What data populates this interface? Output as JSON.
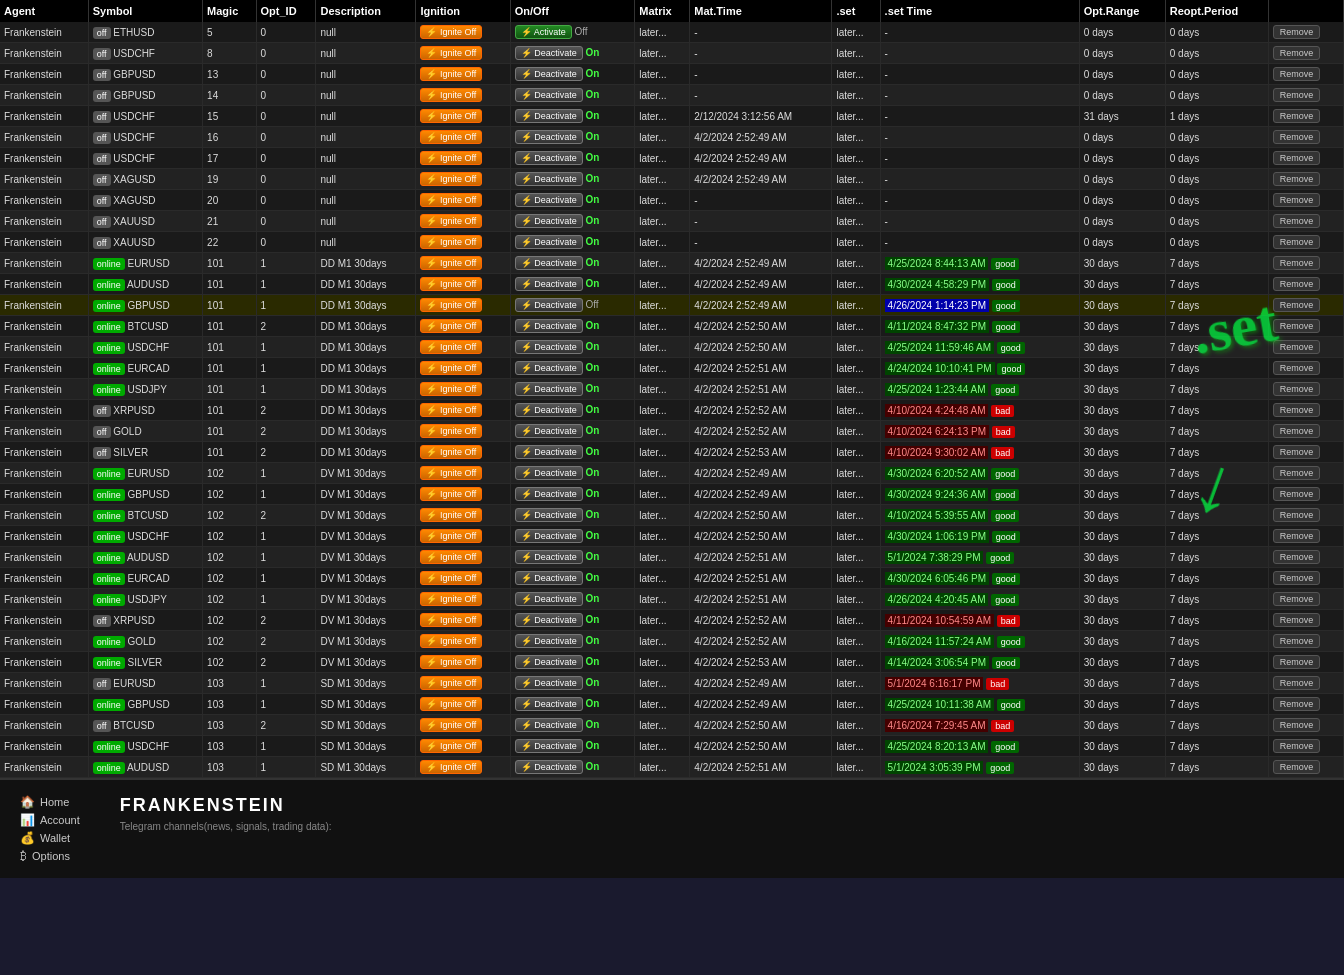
{
  "watermark": {
    "text": ".set",
    "arrow": "↓"
  },
  "table": {
    "headers": [
      "Agent",
      "Symbol",
      "Magic",
      "Opt_ID",
      "Description",
      "Ignition",
      "On/Off",
      "Matrix",
      "Mat.Time",
      ".set",
      ".set Time",
      "Opt.Range",
      "Reopt.Period",
      ""
    ],
    "rows": [
      {
        "agent": "Frankenstein",
        "status": "off",
        "symbol": "ETHUSD",
        "magic": 5,
        "opt_id": 0,
        "desc": "null",
        "ignition": "Ignite",
        "onoff_btn": "Activate",
        "onoff_state": "Off",
        "matrix": "later...",
        "mat_time": "-",
        "set": "later...",
        "set_time": "-",
        "set_quality": "",
        "opt_range": "0 days",
        "reopt": "0 days"
      },
      {
        "agent": "Frankenstein",
        "status": "off",
        "symbol": "USDCHF",
        "magic": 8,
        "opt_id": 0,
        "desc": "null",
        "ignition": "Ignite",
        "onoff_btn": "Deactivate",
        "onoff_state": "On",
        "matrix": "later...",
        "mat_time": "-",
        "set": "later...",
        "set_time": "-",
        "set_quality": "",
        "opt_range": "0 days",
        "reopt": "0 days"
      },
      {
        "agent": "Frankenstein",
        "status": "off",
        "symbol": "GBPUSD",
        "magic": 13,
        "opt_id": 0,
        "desc": "null",
        "ignition": "Ignite",
        "onoff_btn": "Deactivate",
        "onoff_state": "On",
        "matrix": "later...",
        "mat_time": "-",
        "set": "later...",
        "set_time": "-",
        "set_quality": "",
        "opt_range": "0 days",
        "reopt": "0 days"
      },
      {
        "agent": "Frankenstein",
        "status": "off",
        "symbol": "GBPUSD",
        "magic": 14,
        "opt_id": 0,
        "desc": "null",
        "ignition": "Ignite",
        "onoff_btn": "Deactivate",
        "onoff_state": "On",
        "matrix": "later...",
        "mat_time": "-",
        "set": "later...",
        "set_time": "-",
        "set_quality": "",
        "opt_range": "0 days",
        "reopt": "0 days"
      },
      {
        "agent": "Frankenstein",
        "status": "off",
        "symbol": "USDCHF",
        "magic": 15,
        "opt_id": 0,
        "desc": "null",
        "ignition": "Ignite",
        "onoff_btn": "Deactivate",
        "onoff_state": "On",
        "matrix": "later...",
        "mat_time": "2/12/2024 3:12:56 AM",
        "set": "later...",
        "set_time": "-",
        "set_quality": "",
        "opt_range": "31 days",
        "reopt": "1 days"
      },
      {
        "agent": "Frankenstein",
        "status": "off",
        "symbol": "USDCHF",
        "magic": 16,
        "opt_id": 0,
        "desc": "null",
        "ignition": "Ignite",
        "onoff_btn": "Deactivate",
        "onoff_state": "On",
        "matrix": "later...",
        "mat_time": "4/2/2024 2:52:49 AM",
        "set": "later...",
        "set_time": "-",
        "set_quality": "",
        "opt_range": "0 days",
        "reopt": "0 days"
      },
      {
        "agent": "Frankenstein",
        "status": "off",
        "symbol": "USDCHF",
        "magic": 17,
        "opt_id": 0,
        "desc": "null",
        "ignition": "Ignite",
        "onoff_btn": "Deactivate",
        "onoff_state": "On",
        "matrix": "later...",
        "mat_time": "4/2/2024 2:52:49 AM",
        "set": "later...",
        "set_time": "-",
        "set_quality": "",
        "opt_range": "0 days",
        "reopt": "0 days"
      },
      {
        "agent": "Frankenstein",
        "status": "off",
        "symbol": "XAGUSD",
        "magic": 19,
        "opt_id": 0,
        "desc": "null",
        "ignition": "Ignite",
        "onoff_btn": "Deactivate",
        "onoff_state": "On",
        "matrix": "later...",
        "mat_time": "4/2/2024 2:52:49 AM",
        "set": "later...",
        "set_time": "-",
        "set_quality": "",
        "opt_range": "0 days",
        "reopt": "0 days"
      },
      {
        "agent": "Frankenstein",
        "status": "off",
        "symbol": "XAGUSD",
        "magic": 20,
        "opt_id": 0,
        "desc": "null",
        "ignition": "Ignite",
        "onoff_btn": "Deactivate",
        "onoff_state": "On",
        "matrix": "later...",
        "mat_time": "-",
        "set": "later...",
        "set_time": "-",
        "set_quality": "",
        "opt_range": "0 days",
        "reopt": "0 days"
      },
      {
        "agent": "Frankenstein",
        "status": "off",
        "symbol": "XAUUSD",
        "magic": 21,
        "opt_id": 0,
        "desc": "null",
        "ignition": "Ignite",
        "onoff_btn": "Deactivate",
        "onoff_state": "On",
        "matrix": "later...",
        "mat_time": "-",
        "set": "later...",
        "set_time": "-",
        "set_quality": "",
        "opt_range": "0 days",
        "reopt": "0 days"
      },
      {
        "agent": "Frankenstein",
        "status": "off",
        "symbol": "XAUUSD",
        "magic": 22,
        "opt_id": 0,
        "desc": "null",
        "ignition": "Ignite",
        "onoff_btn": "Deactivate",
        "onoff_state": "On",
        "matrix": "later...",
        "mat_time": "-",
        "set": "later...",
        "set_time": "-",
        "set_quality": "",
        "opt_range": "0 days",
        "reopt": "0 days"
      },
      {
        "agent": "Frankenstein",
        "status": "online",
        "symbol": "EURUSD",
        "magic": 101,
        "opt_id": 1,
        "desc": "DD M1 30days",
        "ignition": "Ignite",
        "onoff_btn": "Deactivate",
        "onoff_state": "On",
        "matrix": "later...",
        "mat_time": "4/2/2024 2:52:49 AM",
        "set": "later...",
        "set_time": "4/25/2024 8:44:13 AM",
        "set_quality": "good",
        "opt_range": "30 days",
        "reopt": "7 days"
      },
      {
        "agent": "Frankenstein",
        "status": "online",
        "symbol": "AUDUSD",
        "magic": 101,
        "opt_id": 1,
        "desc": "DD M1 30days",
        "ignition": "Ignite",
        "onoff_btn": "Deactivate",
        "onoff_state": "On",
        "matrix": "later...",
        "mat_time": "4/2/2024 2:52:49 AM",
        "set": "later...",
        "set_time": "4/30/2024 4:58:29 PM",
        "set_quality": "good",
        "opt_range": "30 days",
        "reopt": "7 days"
      },
      {
        "agent": "Frankenstein",
        "status": "online",
        "symbol": "GBPUSD",
        "magic": 101,
        "opt_id": 1,
        "desc": "DD M1 30days",
        "ignition": "Ignite",
        "onoff_btn": "Deactivate",
        "onoff_state": "Off",
        "matrix": "later...",
        "mat_time": "4/2/2024 2:52:49 AM",
        "set": "later...",
        "set_time": "4/26/2024 1:14:23 PM",
        "set_quality": "good",
        "opt_range": "30 days",
        "reopt": "7 days",
        "highlight": true
      },
      {
        "agent": "Frankenstein",
        "status": "online",
        "symbol": "BTCUSD",
        "magic": 101,
        "opt_id": 2,
        "desc": "DD M1 30days",
        "ignition": "Ignite",
        "onoff_btn": "Deactivate",
        "onoff_state": "On",
        "matrix": "later...",
        "mat_time": "4/2/2024 2:52:50 AM",
        "set": "later...",
        "set_time": "4/11/2024 8:47:32 PM",
        "set_quality": "good",
        "opt_range": "30 days",
        "reopt": "7 days"
      },
      {
        "agent": "Frankenstein",
        "status": "online",
        "symbol": "USDCHF",
        "magic": 101,
        "opt_id": 1,
        "desc": "DD M1 30days",
        "ignition": "Ignite",
        "onoff_btn": "Deactivate",
        "onoff_state": "On",
        "matrix": "later...",
        "mat_time": "4/2/2024 2:52:50 AM",
        "set": "later...",
        "set_time": "4/25/2024 11:59:46 AM",
        "set_quality": "good",
        "opt_range": "30 days",
        "reopt": "7 days"
      },
      {
        "agent": "Frankenstein",
        "status": "online",
        "symbol": "EURCAD",
        "magic": 101,
        "opt_id": 1,
        "desc": "DD M1 30days",
        "ignition": "Ignite",
        "onoff_btn": "Deactivate",
        "onoff_state": "On",
        "matrix": "later...",
        "mat_time": "4/2/2024 2:52:51 AM",
        "set": "later...",
        "set_time": "4/24/2024 10:10:41 PM",
        "set_quality": "good",
        "opt_range": "30 days",
        "reopt": "7 days"
      },
      {
        "agent": "Frankenstein",
        "status": "online",
        "symbol": "USDJPY",
        "magic": 101,
        "opt_id": 1,
        "desc": "DD M1 30days",
        "ignition": "Ignite",
        "onoff_btn": "Deactivate",
        "onoff_state": "On",
        "matrix": "later...",
        "mat_time": "4/2/2024 2:52:51 AM",
        "set": "later...",
        "set_time": "4/25/2024 1:23:44 AM",
        "set_quality": "good",
        "opt_range": "30 days",
        "reopt": "7 days"
      },
      {
        "agent": "Frankenstein",
        "status": "off",
        "symbol": "XRPUSD",
        "magic": 101,
        "opt_id": 2,
        "desc": "DD M1 30days",
        "ignition": "Ignite",
        "onoff_btn": "Deactivate",
        "onoff_state": "On",
        "matrix": "later...",
        "mat_time": "4/2/2024 2:52:52 AM",
        "set": "later...",
        "set_time": "4/10/2024 4:24:48 AM",
        "set_quality": "bad",
        "opt_range": "30 days",
        "reopt": "7 days"
      },
      {
        "agent": "Frankenstein",
        "status": "off",
        "symbol": "GOLD",
        "magic": 101,
        "opt_id": 2,
        "desc": "DD M1 30days",
        "ignition": "Ignite",
        "onoff_btn": "Deactivate",
        "onoff_state": "On",
        "matrix": "later...",
        "mat_time": "4/2/2024 2:52:52 AM",
        "set": "later...",
        "set_time": "4/10/2024 6:24:13 PM",
        "set_quality": "bad",
        "opt_range": "30 days",
        "reopt": "7 days"
      },
      {
        "agent": "Frankenstein",
        "status": "off",
        "symbol": "SILVER",
        "magic": 101,
        "opt_id": 2,
        "desc": "DD M1 30days",
        "ignition": "Ignite",
        "onoff_btn": "Deactivate",
        "onoff_state": "On",
        "matrix": "later...",
        "mat_time": "4/2/2024 2:52:53 AM",
        "set": "later...",
        "set_time": "4/10/2024 9:30:02 AM",
        "set_quality": "bad",
        "opt_range": "30 days",
        "reopt": "7 days"
      },
      {
        "agent": "Frankenstein",
        "status": "online",
        "symbol": "EURUSD",
        "magic": 102,
        "opt_id": 1,
        "desc": "DV M1 30days",
        "ignition": "Ignite",
        "onoff_btn": "Deactivate",
        "onoff_state": "On",
        "matrix": "later...",
        "mat_time": "4/2/2024 2:52:49 AM",
        "set": "later...",
        "set_time": "4/30/2024 6:20:52 AM",
        "set_quality": "good",
        "opt_range": "30 days",
        "reopt": "7 days"
      },
      {
        "agent": "Frankenstein",
        "status": "online",
        "symbol": "GBPUSD",
        "magic": 102,
        "opt_id": 1,
        "desc": "DV M1 30days",
        "ignition": "Ignite",
        "onoff_btn": "Deactivate",
        "onoff_state": "On",
        "matrix": "later...",
        "mat_time": "4/2/2024 2:52:49 AM",
        "set": "later...",
        "set_time": "4/30/2024 9:24:36 AM",
        "set_quality": "good",
        "opt_range": "30 days",
        "reopt": "7 days"
      },
      {
        "agent": "Frankenstein",
        "status": "online",
        "symbol": "BTCUSD",
        "magic": 102,
        "opt_id": 2,
        "desc": "DV M1 30days",
        "ignition": "Ignite",
        "onoff_btn": "Deactivate",
        "onoff_state": "On",
        "matrix": "later...",
        "mat_time": "4/2/2024 2:52:50 AM",
        "set": "later...",
        "set_time": "4/10/2024 5:39:55 AM",
        "set_quality": "good",
        "opt_range": "30 days",
        "reopt": "7 days"
      },
      {
        "agent": "Frankenstein",
        "status": "online",
        "symbol": "USDCHF",
        "magic": 102,
        "opt_id": 1,
        "desc": "DV M1 30days",
        "ignition": "Ignite",
        "onoff_btn": "Deactivate",
        "onoff_state": "On",
        "matrix": "later...",
        "mat_time": "4/2/2024 2:52:50 AM",
        "set": "later...",
        "set_time": "4/30/2024 1:06:19 PM",
        "set_quality": "good",
        "opt_range": "30 days",
        "reopt": "7 days"
      },
      {
        "agent": "Frankenstein",
        "status": "online",
        "symbol": "AUDUSD",
        "magic": 102,
        "opt_id": 1,
        "desc": "DV M1 30days",
        "ignition": "Ignite",
        "onoff_btn": "Deactivate",
        "onoff_state": "On",
        "matrix": "later...",
        "mat_time": "4/2/2024 2:52:51 AM",
        "set": "later...",
        "set_time": "5/1/2024 7:38:29 PM",
        "set_quality": "good",
        "opt_range": "30 days",
        "reopt": "7 days"
      },
      {
        "agent": "Frankenstein",
        "status": "online",
        "symbol": "EURCAD",
        "magic": 102,
        "opt_id": 1,
        "desc": "DV M1 30days",
        "ignition": "Ignite",
        "onoff_btn": "Deactivate",
        "onoff_state": "On",
        "matrix": "later...",
        "mat_time": "4/2/2024 2:52:51 AM",
        "set": "later...",
        "set_time": "4/30/2024 6:05:46 PM",
        "set_quality": "good",
        "opt_range": "30 days",
        "reopt": "7 days"
      },
      {
        "agent": "Frankenstein",
        "status": "online",
        "symbol": "USDJPY",
        "magic": 102,
        "opt_id": 1,
        "desc": "DV M1 30days",
        "ignition": "Ignite",
        "onoff_btn": "Deactivate",
        "onoff_state": "On",
        "matrix": "later...",
        "mat_time": "4/2/2024 2:52:51 AM",
        "set": "later...",
        "set_time": "4/26/2024 4:20:45 AM",
        "set_quality": "good",
        "opt_range": "30 days",
        "reopt": "7 days"
      },
      {
        "agent": "Frankenstein",
        "status": "off",
        "symbol": "XRPUSD",
        "magic": 102,
        "opt_id": 2,
        "desc": "DV M1 30days",
        "ignition": "Ignite",
        "onoff_btn": "Deactivate",
        "onoff_state": "On",
        "matrix": "later...",
        "mat_time": "4/2/2024 2:52:52 AM",
        "set": "later...",
        "set_time": "4/11/2024 10:54:59 AM",
        "set_quality": "bad",
        "opt_range": "30 days",
        "reopt": "7 days"
      },
      {
        "agent": "Frankenstein",
        "status": "online",
        "symbol": "GOLD",
        "magic": 102,
        "opt_id": 2,
        "desc": "DV M1 30days",
        "ignition": "Ignite",
        "onoff_btn": "Deactivate",
        "onoff_state": "On",
        "matrix": "later...",
        "mat_time": "4/2/2024 2:52:52 AM",
        "set": "later...",
        "set_time": "4/16/2024 11:57:24 AM",
        "set_quality": "good",
        "opt_range": "30 days",
        "reopt": "7 days"
      },
      {
        "agent": "Frankenstein",
        "status": "online",
        "symbol": "SILVER",
        "magic": 102,
        "opt_id": 2,
        "desc": "DV M1 30days",
        "ignition": "Ignite",
        "onoff_btn": "Deactivate",
        "onoff_state": "On",
        "matrix": "later...",
        "mat_time": "4/2/2024 2:52:53 AM",
        "set": "later...",
        "set_time": "4/14/2024 3:06:54 PM",
        "set_quality": "good",
        "opt_range": "30 days",
        "reopt": "7 days"
      },
      {
        "agent": "Frankenstein",
        "status": "off",
        "symbol": "EURUSD",
        "magic": 103,
        "opt_id": 1,
        "desc": "SD M1 30days",
        "ignition": "Ignite",
        "onoff_btn": "Deactivate",
        "onoff_state": "On",
        "matrix": "later...",
        "mat_time": "4/2/2024 2:52:49 AM",
        "set": "later...",
        "set_time": "5/1/2024 6:16:17 PM",
        "set_quality": "bad",
        "opt_range": "30 days",
        "reopt": "7 days"
      },
      {
        "agent": "Frankenstein",
        "status": "online",
        "symbol": "GBPUSD",
        "magic": 103,
        "opt_id": 1,
        "desc": "SD M1 30days",
        "ignition": "Ignite",
        "onoff_btn": "Deactivate",
        "onoff_state": "On",
        "matrix": "later...",
        "mat_time": "4/2/2024 2:52:49 AM",
        "set": "later...",
        "set_time": "4/25/2024 10:11:38 AM",
        "set_quality": "good",
        "opt_range": "30 days",
        "reopt": "7 days"
      },
      {
        "agent": "Frankenstein",
        "status": "off",
        "symbol": "BTCUSD",
        "magic": 103,
        "opt_id": 2,
        "desc": "SD M1 30days",
        "ignition": "Ignite",
        "onoff_btn": "Deactivate",
        "onoff_state": "On",
        "matrix": "later...",
        "mat_time": "4/2/2024 2:52:50 AM",
        "set": "later...",
        "set_time": "4/16/2024 7:29:45 AM",
        "set_quality": "bad",
        "opt_range": "30 days",
        "reopt": "7 days"
      },
      {
        "agent": "Frankenstein",
        "status": "online",
        "symbol": "USDCHF",
        "magic": 103,
        "opt_id": 1,
        "desc": "SD M1 30days",
        "ignition": "Ignite",
        "onoff_btn": "Deactivate",
        "onoff_state": "On",
        "matrix": "later...",
        "mat_time": "4/2/2024 2:52:50 AM",
        "set": "later...",
        "set_time": "4/25/2024 8:20:13 AM",
        "set_quality": "good",
        "opt_range": "30 days",
        "reopt": "7 days"
      },
      {
        "agent": "Frankenstein",
        "status": "online",
        "symbol": "AUDUSD",
        "magic": 103,
        "opt_id": 1,
        "desc": "SD M1 30days",
        "ignition": "Ignite",
        "onoff_btn": "Deactivate",
        "onoff_state": "On",
        "matrix": "later...",
        "mat_time": "4/2/2024 2:52:51 AM",
        "set": "later...",
        "set_time": "5/1/2024 3:05:39 PM",
        "set_quality": "good",
        "opt_range": "30 days",
        "reopt": "7 days"
      }
    ]
  },
  "footer": {
    "brand": "FRANKENSTEIN",
    "tagline": "Telegram channels(news, signals, trading data):",
    "nav": [
      {
        "label": "Home",
        "icon": "🏠"
      },
      {
        "label": "Account",
        "icon": "📊"
      },
      {
        "label": "Wallet",
        "icon": "💰"
      },
      {
        "label": "Options",
        "icon": "₿"
      }
    ]
  }
}
